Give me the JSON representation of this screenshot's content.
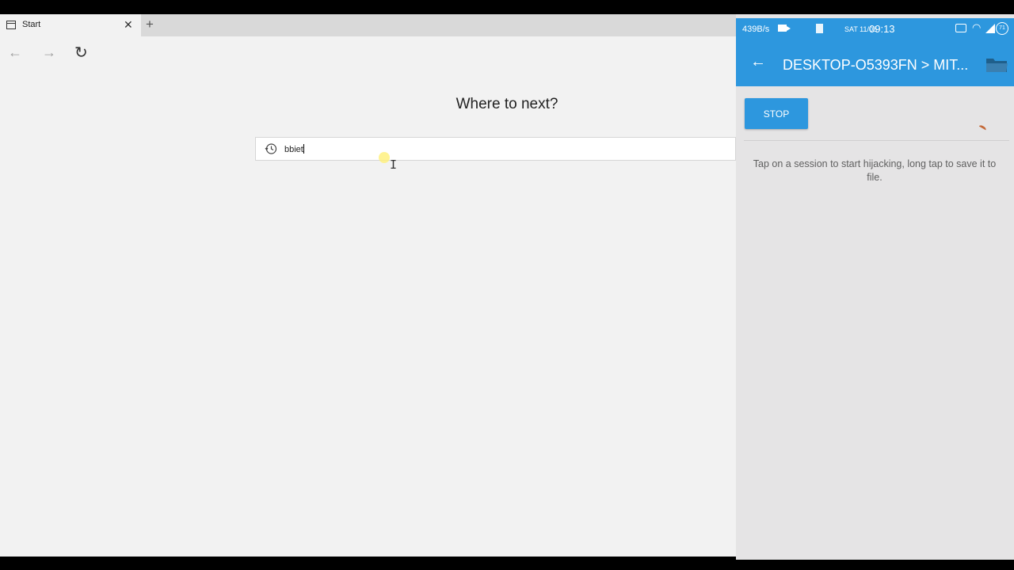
{
  "browser": {
    "tab": {
      "title": "Start",
      "icon": "page-icon"
    },
    "nav": {
      "back_icon": "arrow-left-icon",
      "forward_icon": "arrow-right-icon",
      "refresh_icon": "refresh-icon"
    },
    "start": {
      "heading": "Where to next?"
    },
    "search": {
      "value": "bbiet",
      "icon": "history-icon"
    }
  },
  "phone": {
    "status": {
      "speed": "439B/s",
      "date": "SAT 11/06",
      "time": "09:13",
      "battery": "71"
    },
    "toolbar": {
      "title": "DESKTOP-O5393FN > MIT...",
      "accent": "#2d97de"
    },
    "stop_label": "STOP",
    "hint": "Tap on a session to start hijacking, long tap to save it to file."
  }
}
